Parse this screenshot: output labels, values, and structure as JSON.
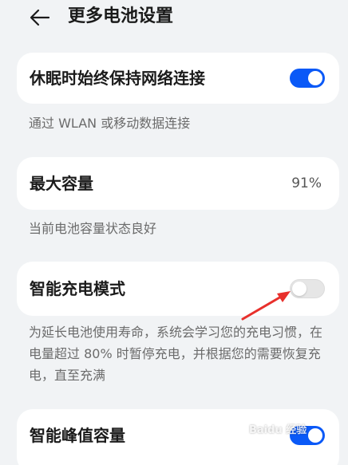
{
  "header": {
    "title": "更多电池设置",
    "back_icon": "arrow-left-icon"
  },
  "settings": [
    {
      "label": "休眠时始终保持网络连接",
      "control": "switch",
      "enabled": true,
      "description": "通过 WLAN 或移动数据连接"
    },
    {
      "label": "最大容量",
      "value": "91%",
      "description": "当前电池容量状态良好"
    },
    {
      "label": "智能充电模式",
      "control": "switch",
      "enabled": false,
      "description": "为延长电池使用寿命，系统会学习您的充电习惯，在电量超过 80% 时暂停充电，并根据您的需要恢复充电，直至充满"
    },
    {
      "label": "智能峰值容量",
      "control": "switch",
      "enabled": true
    }
  ],
  "colors": {
    "accent": "#0a59f7",
    "annotation_arrow": "#e8302c",
    "background": "#f1f3f5",
    "card": "#ffffff"
  },
  "watermark": {
    "text": "Baidu 经验",
    "url": "jingyan.baidu.com"
  }
}
